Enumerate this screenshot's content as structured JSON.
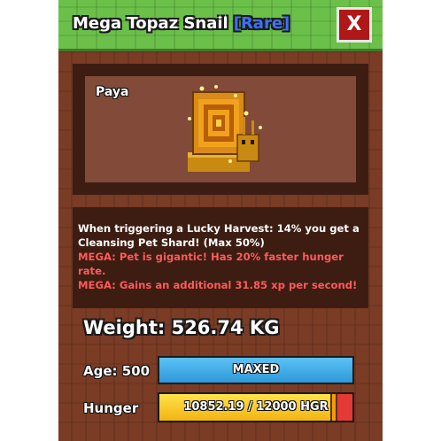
{
  "header": {
    "title": "Mega Topaz Snail",
    "rarity": "[Rare]",
    "close_label": "X"
  },
  "pet": {
    "owner": "Paya",
    "icon": "topaz-snail-icon"
  },
  "description": {
    "ability": "When triggering a Lucky Harvest: 14% you get a Cleansing Pet Shard! (Max 50%)",
    "ability_lines": [
      "When triggering a Lucky Harvest: 14% you get a",
      "Cleansing Pet Shard! (Max 50%)"
    ],
    "mega_lines": [
      "MEGA: Pet is gigantic! Has 20% faster hunger",
      "rate.",
      "MEGA: Gains an additional 31.85 xp per second!"
    ]
  },
  "stats": {
    "weight_text": "Weight: 526.74 KG",
    "age_label": "Age: 500",
    "age_bar_text": "MAXED",
    "hunger_label": "Hunger",
    "hunger_text": "10852.19 / 12000 HGR",
    "hunger_current": 10852.19,
    "hunger_max": 12000
  },
  "colors": {
    "header_green": "#6bc04a",
    "panel_brown": "#7a3c25",
    "rarity_blue": "#3f6fff",
    "close_red": "#b01818",
    "mega_red": "#ff5a5a",
    "age_blue": "#3aa7e6",
    "hunger_yellow": "#f2b413",
    "hunger_empty_red": "#e53935"
  }
}
